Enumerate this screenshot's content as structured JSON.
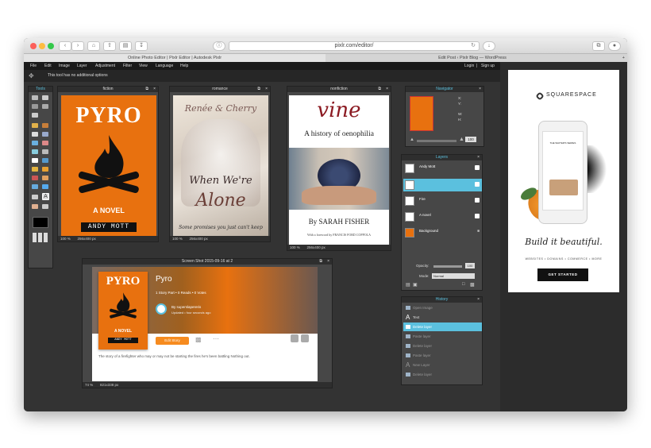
{
  "browser": {
    "url": "pixlr.com/editor/",
    "tabs": [
      "Online Photo Editor | Pixlr Editor | Autodesk Pixlr",
      "Edit Post ‹ Pixlr Blog — WordPress"
    ]
  },
  "menu": [
    "File",
    "Edit",
    "Image",
    "Layer",
    "Adjustment",
    "Filter",
    "View",
    "Language",
    "Help"
  ],
  "account": {
    "login": "Login",
    "signup": "Sign up"
  },
  "options_text": "This tool has no additional options",
  "tools_title": "Tools",
  "panels": {
    "fiction": {
      "title": "fiction",
      "zoom": "100",
      "size": "256x400 px"
    },
    "romance": {
      "title": "romance",
      "zoom": "100",
      "size": "256x400 px"
    },
    "nonfiction": {
      "title": "nonfiction",
      "zoom": "100",
      "size": "256x400 px"
    },
    "screenshot": {
      "title": "Screen Shot 2015-09-16 at 2",
      "zoom": "74",
      "size": "821x338 px"
    }
  },
  "covers": {
    "pyro_title": "PYRO",
    "pyro_subtitle": "A NOVEL",
    "pyro_author": "ANDY MOTT",
    "romance_author": "Renée & Cherry",
    "romance_title1": "When We're",
    "romance_title2": "Alone",
    "romance_tagline": "Some promises you just can't keep",
    "vine_title": "vine",
    "vine_subtitle": "A history of oenophilia",
    "vine_author": "By SARAH FISHER",
    "vine_foreword": "With a foreword by FRANCIS FORD COPPOLA"
  },
  "shot": {
    "book_title": "Pyro",
    "stats": "1 Story Part  •  0 Reads  •  0 Votes",
    "author": "By superslapereris",
    "updated": "Updated • four seconds ago",
    "edit": "Edit Story",
    "description": "The story of a firefighter who may or may not be starting the fires he's been battling Nothing out."
  },
  "navigator": {
    "title": "Navigator",
    "x": "X:",
    "y": "Y:",
    "w": "W:",
    "h": "H:",
    "zoom": "100"
  },
  "layers": {
    "title": "Layers",
    "items": [
      {
        "name": "Andy Mott",
        "color": "#ffffff"
      },
      {
        "name": "",
        "color": "#ffffff"
      },
      {
        "name": "Fire",
        "color": "#ffffff"
      },
      {
        "name": "A novel",
        "color": "#ffffff"
      },
      {
        "name": "Background",
        "color": "#e8710f"
      }
    ],
    "opacity_label": "Opacity:",
    "opacity_value": "100",
    "mode_label": "Mode:",
    "mode_value": "Normal"
  },
  "history": {
    "title": "History",
    "items": [
      "Open Image",
      "Text",
      "Delete layer",
      "Paste layer",
      "Delete layer",
      "Paste layer",
      "New Layer",
      "Delete layer"
    ],
    "selected": 2
  },
  "ad": {
    "brand": "SQUARESPACE",
    "script": "Build it beautiful.",
    "tagline": "WEBSITES • DOMAINS • COMMERCE • MORE",
    "cta": "GET STARTED",
    "phone_text": "THE WAITER'S SERIES"
  },
  "colors": {
    "accent": "#5bc0de",
    "orange": "#e8710f",
    "vine_red": "#8b1a22"
  }
}
